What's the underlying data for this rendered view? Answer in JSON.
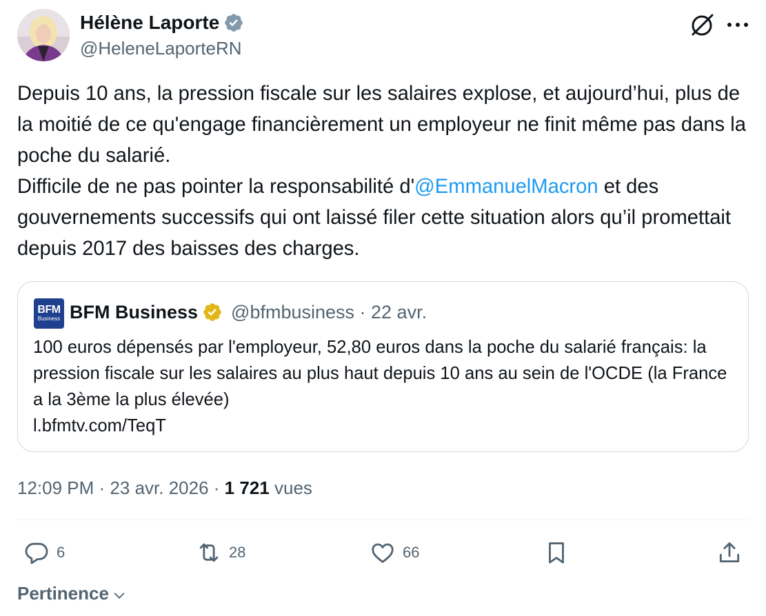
{
  "author": {
    "name": "Hélène Laporte",
    "handle": "@HeleneLaporteRN",
    "verified_color": "#829aab"
  },
  "tweet": {
    "paragraph1": "Depuis 10 ans, la pression fiscale sur les salaires explose, et aujourd’hui, plus de la moitié de ce qu'engage financièrement un employeur ne finit même pas dans la poche du salarié.",
    "paragraph2_before": "Difficile de ne pas pointer la responsabilité d'",
    "mention": "@EmmanuelMacron",
    "paragraph2_after": " et des gouvernements successifs qui ont laissé filer cette situation alors qu’il promettait depuis 2017 des baisses des charges."
  },
  "quote": {
    "logo_line1": "BFM",
    "logo_line2": "Business",
    "name": "BFM Business",
    "meta": "@bfmbusiness · 22 avr.",
    "text": "100 euros dépensés par l'employeur, 52,80 euros dans la poche du salarié français: la pression fiscale sur les salaires au plus haut depuis 10 ans au sein de l'OCDE (la France a la 3ème la plus élevée)",
    "link": "l.bfmtv.com/TeqT",
    "verified_color": "#e2b719"
  },
  "meta": {
    "time": "12:09 PM",
    "date": "23 avr. 2026",
    "views_count": "1 721",
    "views_label": "vues"
  },
  "actions": {
    "replies": "6",
    "reposts": "28",
    "likes": "66"
  },
  "sort": {
    "label": "Pertinence"
  },
  "colors": {
    "accent": "#1d9bf0",
    "secondary_text": "#536471",
    "border": "#cfd9de"
  }
}
